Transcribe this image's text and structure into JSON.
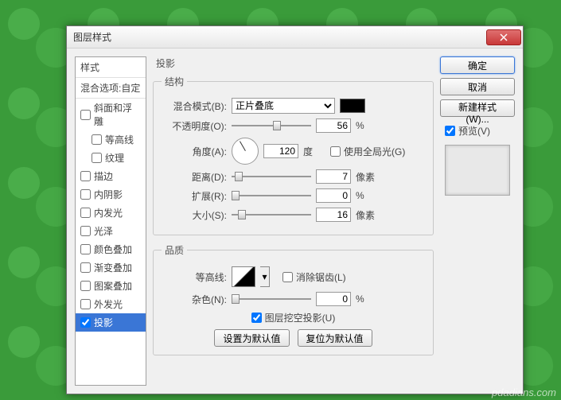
{
  "window": {
    "title": "图层样式"
  },
  "sidebar": {
    "header1": "样式",
    "header2": "混合选项:自定",
    "items": [
      {
        "label": "斜面和浮雕",
        "checked": false,
        "indent": false
      },
      {
        "label": "等高线",
        "checked": false,
        "indent": true
      },
      {
        "label": "纹理",
        "checked": false,
        "indent": true
      },
      {
        "label": "描边",
        "checked": false,
        "indent": false
      },
      {
        "label": "内阴影",
        "checked": false,
        "indent": false
      },
      {
        "label": "内发光",
        "checked": false,
        "indent": false
      },
      {
        "label": "光泽",
        "checked": false,
        "indent": false
      },
      {
        "label": "颜色叠加",
        "checked": false,
        "indent": false
      },
      {
        "label": "渐变叠加",
        "checked": false,
        "indent": false
      },
      {
        "label": "图案叠加",
        "checked": false,
        "indent": false
      },
      {
        "label": "外发光",
        "checked": false,
        "indent": false
      },
      {
        "label": "投影",
        "checked": true,
        "indent": false,
        "selected": true
      }
    ]
  },
  "panel": {
    "title": "投影",
    "group_structure": "结构",
    "group_quality": "品质",
    "blend_mode_label": "混合模式(B):",
    "blend_mode_value": "正片叠底",
    "color": "#000000",
    "opacity_label": "不透明度(O):",
    "opacity_value": "56",
    "opacity_unit": "%",
    "angle_label": "角度(A):",
    "angle_value": "120",
    "angle_unit": "度",
    "global_light_label": "使用全局光(G)",
    "global_light_checked": false,
    "distance_label": "距离(D):",
    "distance_value": "7",
    "distance_unit": "像素",
    "spread_label": "扩展(R):",
    "spread_value": "0",
    "spread_unit": "%",
    "size_label": "大小(S):",
    "size_value": "16",
    "size_unit": "像素",
    "contour_label": "等高线:",
    "antialias_label": "消除锯齿(L)",
    "antialias_checked": false,
    "noise_label": "杂色(N):",
    "noise_value": "0",
    "noise_unit": "%",
    "knockout_label": "图层挖空投影(U)",
    "knockout_checked": true,
    "make_default": "设置为默认值",
    "reset_default": "复位为默认值"
  },
  "buttons": {
    "ok": "确定",
    "cancel": "取消",
    "new_style": "新建样式(W)...",
    "preview": "预览(V)"
  },
  "watermark": "pdadians.com"
}
